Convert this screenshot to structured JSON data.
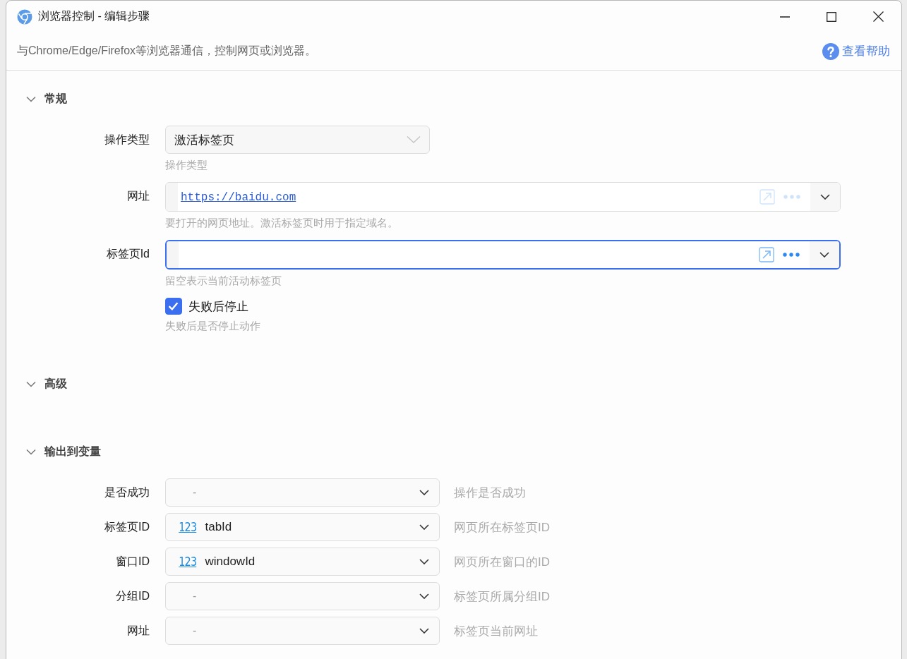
{
  "window": {
    "title": "浏览器控制 - 编辑步骤"
  },
  "description": "与Chrome/Edge/Firefox等浏览器通信，控制网页或浏览器。",
  "help_link": "查看帮助",
  "sections": [
    {
      "title": "常规",
      "expanded": true,
      "fields": [
        {
          "kind": "select",
          "label": "操作类型",
          "value": "激活标签页",
          "hint": "操作类型"
        },
        {
          "kind": "input",
          "label": "网址",
          "value": "https://baidu.com",
          "focused": false,
          "hint": "要打开的网页地址。激活标签页时用于指定域名。"
        },
        {
          "kind": "input",
          "label": "标签页Id",
          "focused": true,
          "hint": "留空表示当前活动标签页"
        },
        {
          "kind": "checkbox",
          "label": "失败后停止",
          "checked": true,
          "hint": "失败后是否停止动作"
        }
      ]
    },
    {
      "title": "高级",
      "expanded": true
    },
    {
      "title": "输出到变量",
      "expanded": true,
      "outputs": [
        {
          "label": "是否成功",
          "kind": "empty",
          "value": "-",
          "hint": "操作是否成功"
        },
        {
          "label": "标签页ID",
          "kind": "variable",
          "type_icon": "123",
          "value": "tabId",
          "hint": "网页所在标签页ID"
        },
        {
          "label": "窗口ID",
          "kind": "variable",
          "type_icon": "123",
          "value": "windowId",
          "hint": "网页所在窗口的ID"
        },
        {
          "label": "分组ID",
          "kind": "empty",
          "value": "-",
          "hint": "标签页所属分组ID"
        },
        {
          "label": "网址",
          "kind": "empty",
          "value": "-",
          "hint": "标签页当前网址"
        }
      ]
    }
  ]
}
